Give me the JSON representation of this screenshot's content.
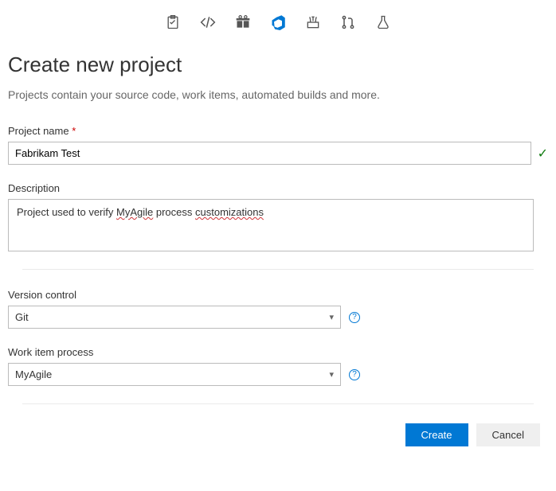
{
  "nav": {
    "items": [
      {
        "name": "work-items-icon"
      },
      {
        "name": "code-icon"
      },
      {
        "name": "gift-icon"
      },
      {
        "name": "devops-logo-icon"
      },
      {
        "name": "build-icon"
      },
      {
        "name": "pull-request-icon"
      },
      {
        "name": "test-flask-icon"
      }
    ]
  },
  "header": {
    "title": "Create new project",
    "subtitle": "Projects contain your source code, work items, automated builds and more."
  },
  "form": {
    "project_name": {
      "label": "Project name",
      "required": "*",
      "value": "Fabrikam Test",
      "valid": "✓"
    },
    "description": {
      "label": "Description",
      "prefix": "Project used to verify ",
      "word1": "MyAgile",
      "middle": " process ",
      "word2": "customizations"
    },
    "version_control": {
      "label": "Version control",
      "selected": "Git",
      "help": "?"
    },
    "work_item_process": {
      "label": "Work item process",
      "selected": "MyAgile",
      "help": "?"
    }
  },
  "actions": {
    "create": "Create",
    "cancel": "Cancel"
  }
}
